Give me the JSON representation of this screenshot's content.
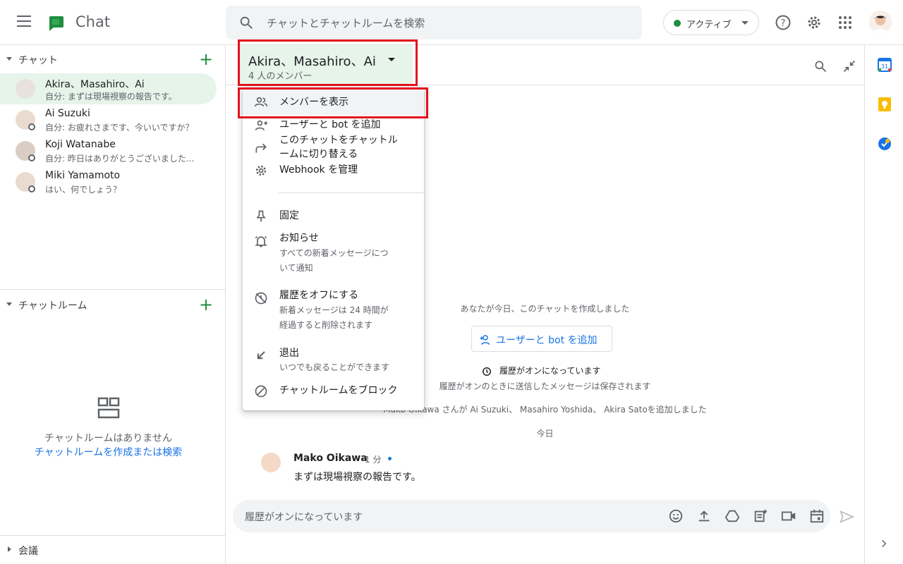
{
  "app": {
    "title": "Chat"
  },
  "search": {
    "placeholder": "チャットとチャットルームを検索"
  },
  "status": {
    "label": "アクティブ",
    "color": "#1e8e3e"
  },
  "sidebar": {
    "chats_header": "チャット",
    "rooms_header": "チャットルーム",
    "meetings_header": "会議",
    "items": [
      {
        "name": "Akira、Masahiro、Ai",
        "preview": "自分: まずは現場視察の報告です。",
        "selected": true
      },
      {
        "name": "Ai Suzuki",
        "preview": "自分: お疲れさまです、今いいですか？"
      },
      {
        "name": "Koji Watanabe",
        "preview": "自分: 昨日はありがとうございました..."
      },
      {
        "name": "Miki Yamamoto",
        "preview": "はい、何でしょう？"
      }
    ],
    "rooms_empty": "チャットルームはありません",
    "rooms_link": "チャットルームを作成または検索"
  },
  "conversation": {
    "title": "Akira、Masahiro、Ai",
    "subtitle": "4 人のメンバー",
    "created_text": "あなたが今日、このチャットを作成しました",
    "add_button": "ユーザーと bot を追加",
    "history_on": "履歴がオンになっています",
    "history_note": "履歴がオンのときに送信したメッセージは保存されます",
    "added_notice": "Mako Oikawa さんが Ai Suzuki、 Masahiro Yoshida、 Akira Satoを追加しました",
    "day_label": "今日",
    "message": {
      "sender": "Mako Oikawa",
      "time": "1 分",
      "text": "まずは現場視察の報告です。"
    },
    "composer_placeholder": "履歴がオンになっています"
  },
  "menu": {
    "view_members": "メンバーを表示",
    "add_users": "ユーザーと bot を追加",
    "switch_room_1": "このチャットをチャットル",
    "switch_room_2": "ームに切り替える",
    "webhook": "Webhook を管理",
    "pin": "固定",
    "notify": "お知らせ",
    "notify_sub_1": "すべての新着メッセージにつ",
    "notify_sub_2": "いて通知",
    "history_off": "履歴をオフにする",
    "history_sub_1": "新着メッセージは 24 時間が",
    "history_sub_2": "経過すると削除されます",
    "leave": "退出",
    "leave_sub": "いつでも戻ることができます",
    "block": "チャットルームをブロック"
  },
  "colors": {
    "accent_green": "#1e8e3e",
    "link_blue": "#1a73e8",
    "highlight_red": "#e4111d",
    "selected_bg": "#e6f4ea"
  }
}
